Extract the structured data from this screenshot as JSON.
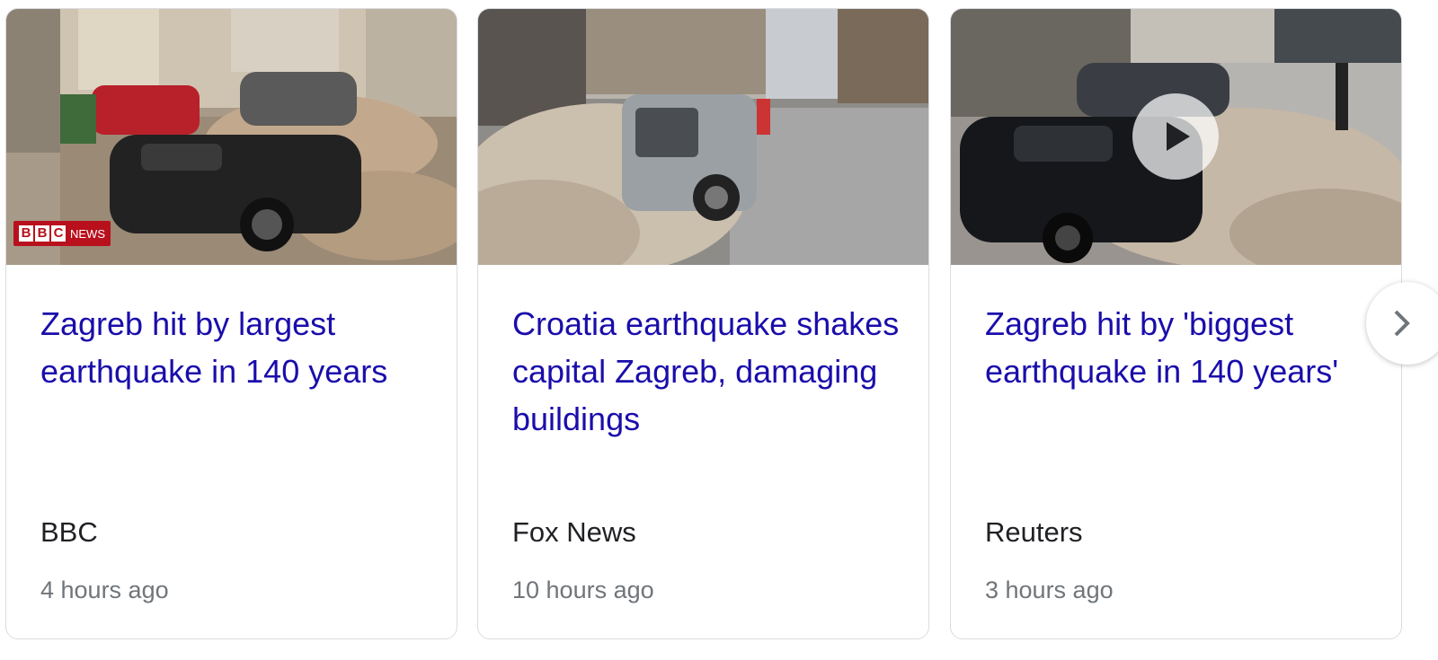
{
  "cards": [
    {
      "headline": "Zagreb hit by largest earthquake in 140 years",
      "source": "BBC",
      "time": "4 hours ago",
      "logo": {
        "letters": [
          "B",
          "B",
          "C"
        ],
        "label": "NEWS"
      }
    },
    {
      "headline": "Croatia earthquake shakes capital Zagreb, damaging buildings",
      "source": "Fox News",
      "time": "10 hours ago"
    },
    {
      "headline": "Zagreb hit by 'biggest earthquake in 140 years'",
      "source": "Reuters",
      "time": "3 hours ago",
      "has_video": true
    }
  ],
  "icons": {
    "play": "play-icon",
    "next": "chevron-right-icon"
  },
  "colors": {
    "headline": "#1a0dab",
    "source": "#202124",
    "time": "#70757a",
    "border": "#dadce0",
    "bbc_red": "#b8101c"
  }
}
